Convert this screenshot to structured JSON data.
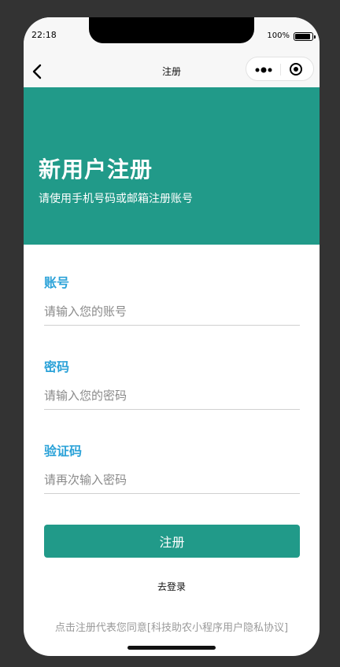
{
  "status_bar": {
    "time": "22:18",
    "battery": "100%",
    "battery_level": 1.0
  },
  "nav": {
    "title": "注册",
    "back_icon": "chevron-left-icon",
    "more_icon": "more-dots-icon",
    "close_icon": "target-circle-icon"
  },
  "banner": {
    "title": "新用户注册",
    "subtitle": "请使用手机号码或邮箱注册账号",
    "color": "#219a89"
  },
  "form": {
    "fields": [
      {
        "label": "账号",
        "value": "",
        "placeholder": "请输入您的账号"
      },
      {
        "label": "密码",
        "value": "",
        "placeholder": "请输入您的密码"
      },
      {
        "label": "验证码",
        "value": "",
        "placeholder": "请再次输入密码"
      }
    ],
    "label_color": "#2ba2d8",
    "submit_label": "注册",
    "login_link": "去登录"
  },
  "agreement": "点击注册代表您同意[科技助农小程序用户隐私协议]"
}
